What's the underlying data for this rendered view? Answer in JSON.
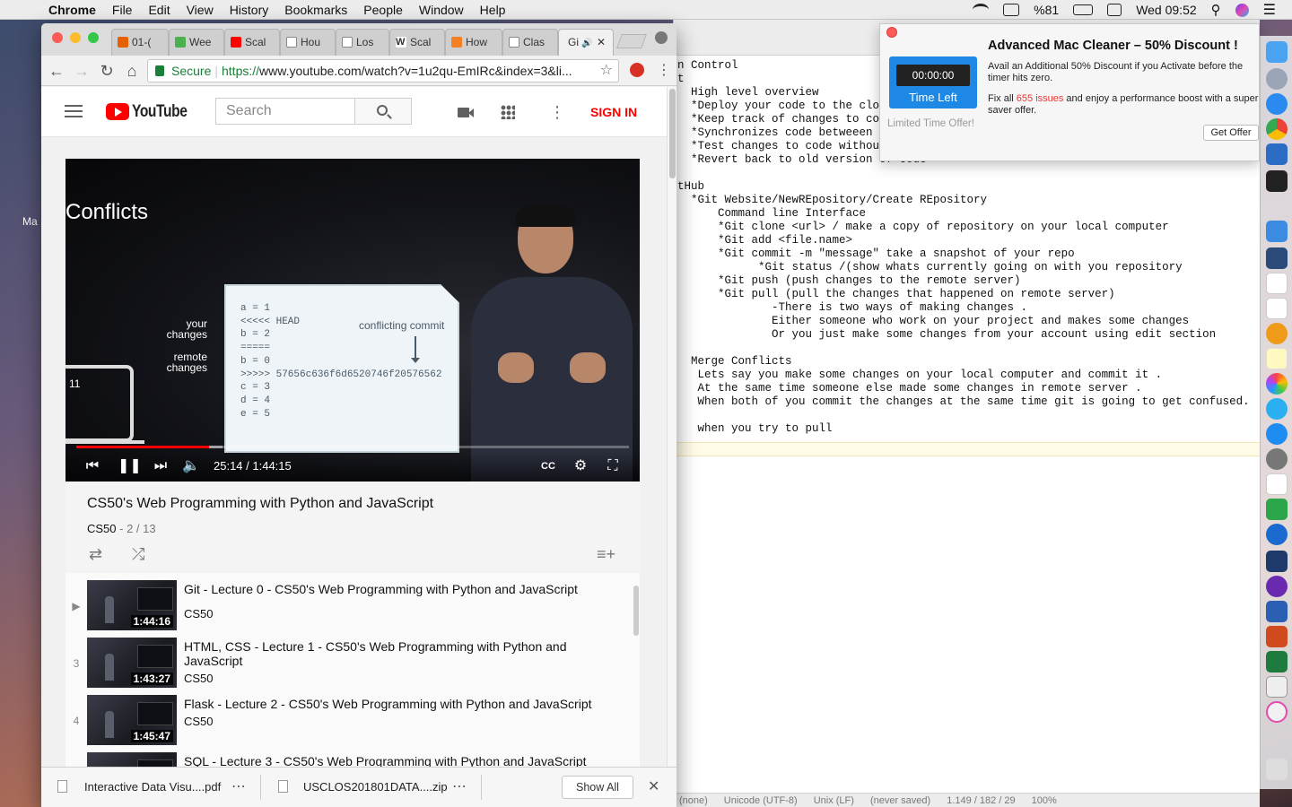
{
  "menubar": {
    "app": "Chrome",
    "menus": [
      "File",
      "Edit",
      "View",
      "History",
      "Bookmarks",
      "People",
      "Window",
      "Help"
    ],
    "battery": "%81",
    "clock": "Wed 09:52"
  },
  "desktop": {
    "label": "Ma"
  },
  "tabs": [
    {
      "label": "01-(",
      "color": "#e66000"
    },
    {
      "label": "Wee",
      "color": "#4caf50"
    },
    {
      "label": "Scal",
      "color": "#ff0000"
    },
    {
      "label": "Hou",
      "color": "#888888"
    },
    {
      "label": "Los",
      "color": "#888888"
    },
    {
      "label": "Scal",
      "color": "#333333"
    },
    {
      "label": "How",
      "color": "#f48024"
    },
    {
      "label": "Clas",
      "color": "#888888"
    },
    {
      "label": "Gi",
      "color": "#888888"
    }
  ],
  "address": {
    "secure": "Secure",
    "scheme": "https://",
    "url": "www.youtube.com/watch?v=1u2qu-EmIRc&index=3&li..."
  },
  "youtube": {
    "logo": "YouTube",
    "search_placeholder": "Search",
    "signin": "SIGN IN"
  },
  "video": {
    "slide_title": "Conflicts",
    "laptop_text": "11",
    "your_changes": "your\nchanges",
    "remote_changes": "remote\nchanges",
    "code": "a = 1\n<<<<< HEAD\nb = 2\n=====\nb = 0\n>>>>> 57656c636f6d6520746f20576562\nc = 3\nd = 4\ne = 5",
    "conflicting_commit": "conflicting commit",
    "time": "25:14 / 1:44:15",
    "progress": 0.241,
    "buffered": 0.265
  },
  "info": {
    "title": "CS50's Web Programming with Python and JavaScript",
    "channel": "CS50",
    "position": " - 2 / 13"
  },
  "playlist": [
    {
      "index": "▶",
      "title": "Git - Lecture 0 - CS50's Web Programming with Python and JavaScript",
      "channel": "CS50",
      "duration": "1:44:16"
    },
    {
      "index": "3",
      "title": "HTML, CSS - Lecture 1 - CS50's Web Programming with Python and JavaScript",
      "channel": "CS50",
      "duration": "1:43:27"
    },
    {
      "index": "4",
      "title": "Flask - Lecture 2 - CS50's Web Programming with Python and JavaScript",
      "channel": "CS50",
      "duration": "1:45:47"
    },
    {
      "index": "5",
      "title": "SQL - Lecture 3 - CS50's Web Programming with Python and JavaScript",
      "channel": "CS50",
      "duration": ""
    }
  ],
  "downloads": [
    {
      "name": "Interactive Data Visu....pdf"
    },
    {
      "name": "USCLOS201801DATA....zip"
    }
  ],
  "downloads_show_all": "Show All",
  "editor": {
    "text": "n Control\nt\n  High level overview\n  *Deploy your code to the clou\n  *Keep track of changes to cod\n  *Synchronizes code betweeen d\n  *Test changes to code without\n  *Revert back to old version of code\n\ntHub\n  *Git Website/NewREpository/Create REpository\n      Command line Interface\n      *Git clone <url> / make a copy of repository on your local computer\n      *Git add <file.name>\n      *Git commit -m \"message\" take a snapshot of your repo\n            *Git status /(show whats currently going on with you repository\n      *Git push (push changes to the remote server)\n      *Git pull (pull the changes that happened on remote server)\n              -There is two ways of making changes .\n              Either someone who work on your project and makes some changes\n              Or you just make some changes from your account using edit section\n\n  Merge Conflicts\n   Lets say you make some changes on your local computer and commit it .\n   At the same time someone else made some changes in remote server .\n   When both of you commit the changes at the same time git is going to get confused.\n\n   when you try to pull",
    "status": [
      "(none)",
      "Unicode (UTF-8)",
      "Unix (LF)",
      "(never saved)",
      "1.149 / 182 / 29",
      "100%"
    ]
  },
  "notification": {
    "title": "Advanced Mac Cleaner – 50% Discount !",
    "timer": "00:00:00",
    "time_left": "Time Left",
    "limited": "Limited Time Offer!",
    "p1": "Avail an Additional 50% Discount if you Activate before the timer hits zero.",
    "p2_a": "Fix all ",
    "p2_issues": "655 issues",
    "p2_b": " and enjoy a performance boost with a super saver offer.",
    "button": "Get Offer"
  }
}
